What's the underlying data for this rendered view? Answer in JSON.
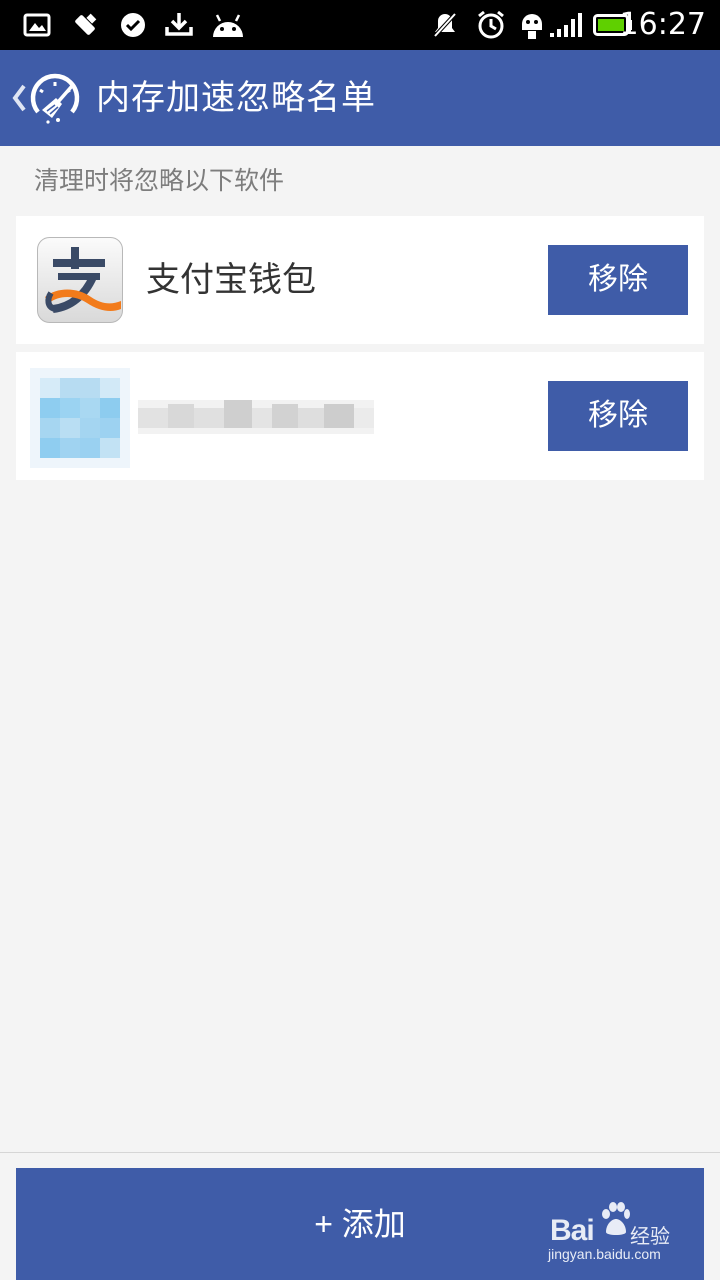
{
  "status_bar": {
    "time": "16:27",
    "icons": [
      "image-icon",
      "signal-tools-icon",
      "check-circle-icon",
      "download-icon",
      "android-icon",
      "muted-bell-icon",
      "alarm-icon",
      "usb-debug-icon",
      "cell-signal-icon",
      "battery-icon"
    ],
    "battery_color": "#5fd000"
  },
  "app_bar": {
    "title": "内存加速忽略名单",
    "color": "#3f5ca8"
  },
  "section": {
    "label": "清理时将忽略以下软件"
  },
  "apps": [
    {
      "name": "支付宝钱包",
      "icon": "alipay-icon",
      "remove_label": "移除"
    },
    {
      "name": "",
      "icon": "blurred-app-icon",
      "remove_label": "移除"
    }
  ],
  "add_button": {
    "label": "+ 添加"
  },
  "watermark": {
    "text": "Bai",
    "text2": "经验",
    "url": "jingyan.baidu.com"
  }
}
